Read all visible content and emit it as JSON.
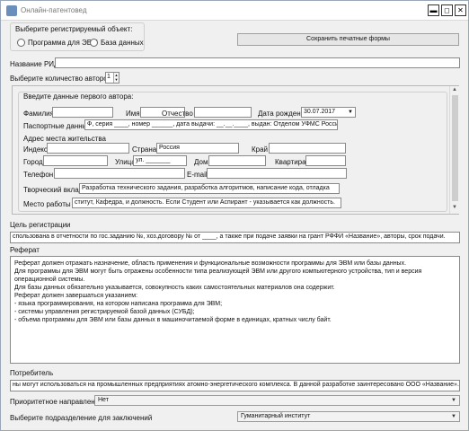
{
  "window": {
    "title": "Онлайн-патентовед",
    "min": "▬",
    "max": "◻",
    "close": "✕"
  },
  "object_type": {
    "group_label": "Выберите регистрируемый объект:",
    "options": [
      "Программа для ЭВМ",
      "База данных"
    ]
  },
  "save_button": "Сохранить печатные формы",
  "rid_name": {
    "label": "Название РИД",
    "value": ""
  },
  "authors_count": {
    "label": "Выберите количество авторов",
    "value": "1"
  },
  "first_author": {
    "group_label": "Введите данные первого автора:",
    "surname": {
      "label": "Фамилия",
      "value": ""
    },
    "name": {
      "label": "Имя",
      "value": ""
    },
    "patronymic": {
      "label": "Отчество",
      "value": ""
    },
    "birth_date": {
      "label": "Дата рождения",
      "value": "30.07.2017"
    },
    "passport": {
      "label": "Паспортные данные",
      "value": "Ф, серия ____, номер ______, дата выдачи: __.__.____, выдан: Отделом УФМС России"
    },
    "address_label": "Адрес места жительства",
    "index": {
      "label": "Индекс",
      "value": ""
    },
    "country": {
      "label": "Страна",
      "value": "Россия"
    },
    "region": {
      "label": "Край",
      "value": ""
    },
    "city": {
      "label": "Город",
      "value": ""
    },
    "street": {
      "label": "Улица",
      "value": "ул. _______"
    },
    "house": {
      "label": "Дом",
      "value": ""
    },
    "apartment": {
      "label": "Квартира",
      "value": ""
    },
    "phone": {
      "label": "Телефон",
      "value": ""
    },
    "email": {
      "label": "E-mail",
      "value": ""
    },
    "contribution": {
      "label": "Творческий вклад",
      "value": "Разработка технического задания, разработка алгоритмов, написание кода, отладка"
    },
    "workplace": {
      "label": "Место работы",
      "value": "ститут, Кафедра, и должность. Если Студент или Аспирант - указывается как должность."
    }
  },
  "purpose": {
    "label": "Цель регистрации",
    "value": "спользована в отчетности по гос.заданию №, хоз.договору № от ____, а также при подаче заявки на грант РФФИ «Название», авторы, срок подачи."
  },
  "abstract": {
    "label": "Реферат",
    "lines": [
      "Реферат должен отражать назначение, область применения и функциональные возможности программы для ЭВМ или базы данных.",
      "Для программы для ЭВМ могут быть отражены особенности типа реализующей ЭВМ или другого компьютерного устройства, тип и версия",
      "операционной системы.",
      "Для базы данных обязательно указывается, совокупность каких самостоятельных материалов она содержит.",
      "Реферат должен завершаться указанием:",
      "- языка программирования, на котором написана программа для ЭВМ;",
      "- системы управления регистрируемой базой данных (СУБД);",
      "- объема программы для ЭВМ или базы данных в машиночитаемой форме в единицах, кратных числу байт."
    ]
  },
  "consumer": {
    "label": "Потребитель",
    "value": "ны могут использоваться на промышленных предприятиях атомно-энергетического комплекса. В данной разработке заинтересовано ООО «Название»."
  },
  "priority": {
    "label": "Приоритетное направление",
    "value": "Нет"
  },
  "subdivision": {
    "label": "Выберите подразделение для заключений",
    "value": "Гуманитарный институт"
  }
}
